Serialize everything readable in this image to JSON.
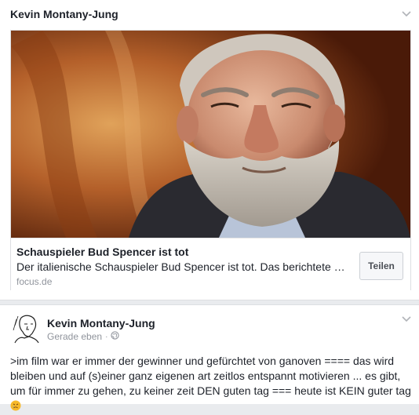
{
  "shared_link_post": {
    "author": "Kevin Montany-Jung",
    "menu_icon": "chevron-down-icon",
    "link": {
      "title": "Schauspieler Bud Spencer ist tot",
      "description": "Der italienische Schauspieler Bud Spencer ist tot. Das berichtete die italienische Nachrichtenagentur ANSA.",
      "domain": "focus.de",
      "share_label": "Teilen",
      "image_icon": "portrait-photo"
    }
  },
  "status_post": {
    "author": "Kevin Montany-Jung",
    "avatar_icon": "sketch-portrait-avatar",
    "timestamp": "Gerade eben",
    "separator": "·",
    "privacy_icon": "globe-icon",
    "menu_icon": "chevron-down-icon",
    "text": ">im film war er immer der gewinner und gefürchtet von ganoven ==== das wird bleiben und auf (s)einer ganz eigenen art zeitlos entspannt motivieren ... es gibt, um für immer zu gehen, zu keiner zeit DEN guten tag === heute ist KEIN  guter tag",
    "emoji_icon": "crying-face-emoji"
  },
  "colors": {
    "background": "#e9ebee",
    "card": "#ffffff",
    "text": "#1d2129",
    "muted": "#90949c",
    "border": "#dddfe2"
  }
}
